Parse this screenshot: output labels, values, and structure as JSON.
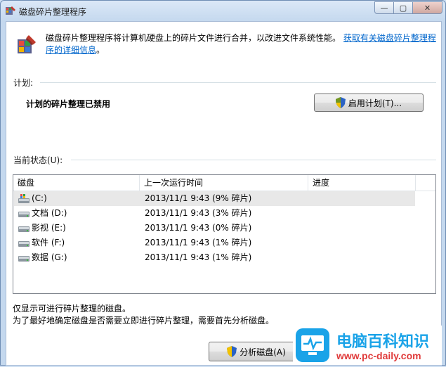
{
  "window": {
    "title": "磁盘碎片整理程序",
    "min": "—",
    "max": "▢",
    "close": "✕"
  },
  "header": {
    "description": "磁盘碎片整理程序将计算机硬盘上的碎片文件进行合并，以改进文件系统性能。",
    "link": "获取有关磁盘碎片整理程序的详细信息",
    "link_tail": "。"
  },
  "schedule": {
    "label": "计划:",
    "status": "计划的碎片整理已禁用",
    "button_label": "启用计划(T)..."
  },
  "current": {
    "label": "当前状态(U):",
    "columns": [
      "磁盘",
      "上一次运行时间",
      "进度"
    ],
    "rows": [
      {
        "disk": "(C:)",
        "last_run": "2013/11/1 9:43 (9% 碎片)",
        "progress": "",
        "icon": "system-drive-icon"
      },
      {
        "disk": "文档 (D:)",
        "last_run": "2013/11/1 9:43 (3% 碎片)",
        "progress": "",
        "icon": "drive-icon"
      },
      {
        "disk": "影视 (E:)",
        "last_run": "2013/11/1 9:43 (0% 碎片)",
        "progress": "",
        "icon": "drive-icon"
      },
      {
        "disk": "软件 (F:)",
        "last_run": "2013/11/1 9:43 (1% 碎片)",
        "progress": "",
        "icon": "drive-icon"
      },
      {
        "disk": "数据 (G:)",
        "last_run": "2013/11/1 9:43 (1% 碎片)",
        "progress": "",
        "icon": "drive-icon"
      }
    ]
  },
  "notes": [
    "仅显示可进行碎片整理的磁盘。",
    "为了最好地确定磁盘是否需要立即进行碎片整理，需要首先分析磁盘。"
  ],
  "footer": {
    "analyze_label": "分析磁盘(A)"
  }
}
